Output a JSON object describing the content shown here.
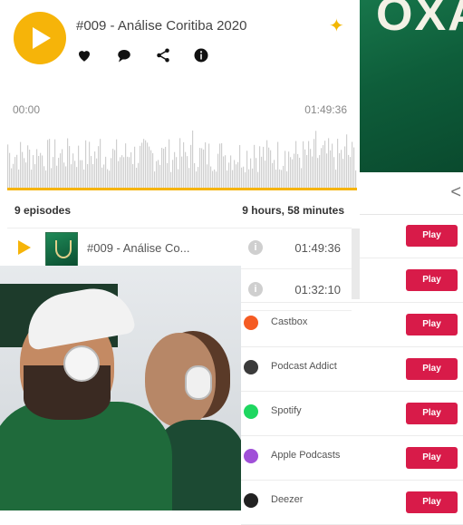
{
  "player": {
    "episode_title": "#009 - Análise Coritiba 2020",
    "time_start": "00:00",
    "time_end": "01:49:36",
    "episodes_count": "9 episodes",
    "total_duration": "9 hours, 58 minutes"
  },
  "episodes": [
    {
      "title": "#009 - Análise Co...",
      "duration": "01:49:36"
    },
    {
      "title": "",
      "duration": "01:32:10"
    }
  ],
  "platforms": [
    {
      "name": "",
      "play_label": "Play",
      "icon_color": "#ffffff"
    },
    {
      "name": "",
      "play_label": "Play",
      "icon_color": "#ffffff"
    },
    {
      "name": "Castbox",
      "play_label": "Play",
      "icon_color": "#f55b23"
    },
    {
      "name": "Podcast Addict",
      "play_label": "Play",
      "icon_color": "#3a3a3a"
    },
    {
      "name": "Spotify",
      "play_label": "Play",
      "icon_color": "#1ed760"
    },
    {
      "name": "Apple Podcasts",
      "play_label": "Play",
      "icon_color": "#a050d8"
    },
    {
      "name": "Deezer",
      "play_label": "Play",
      "icon_color": "#222222"
    }
  ],
  "colors": {
    "accent": "#f6b409",
    "play_button": "#d81b49"
  }
}
